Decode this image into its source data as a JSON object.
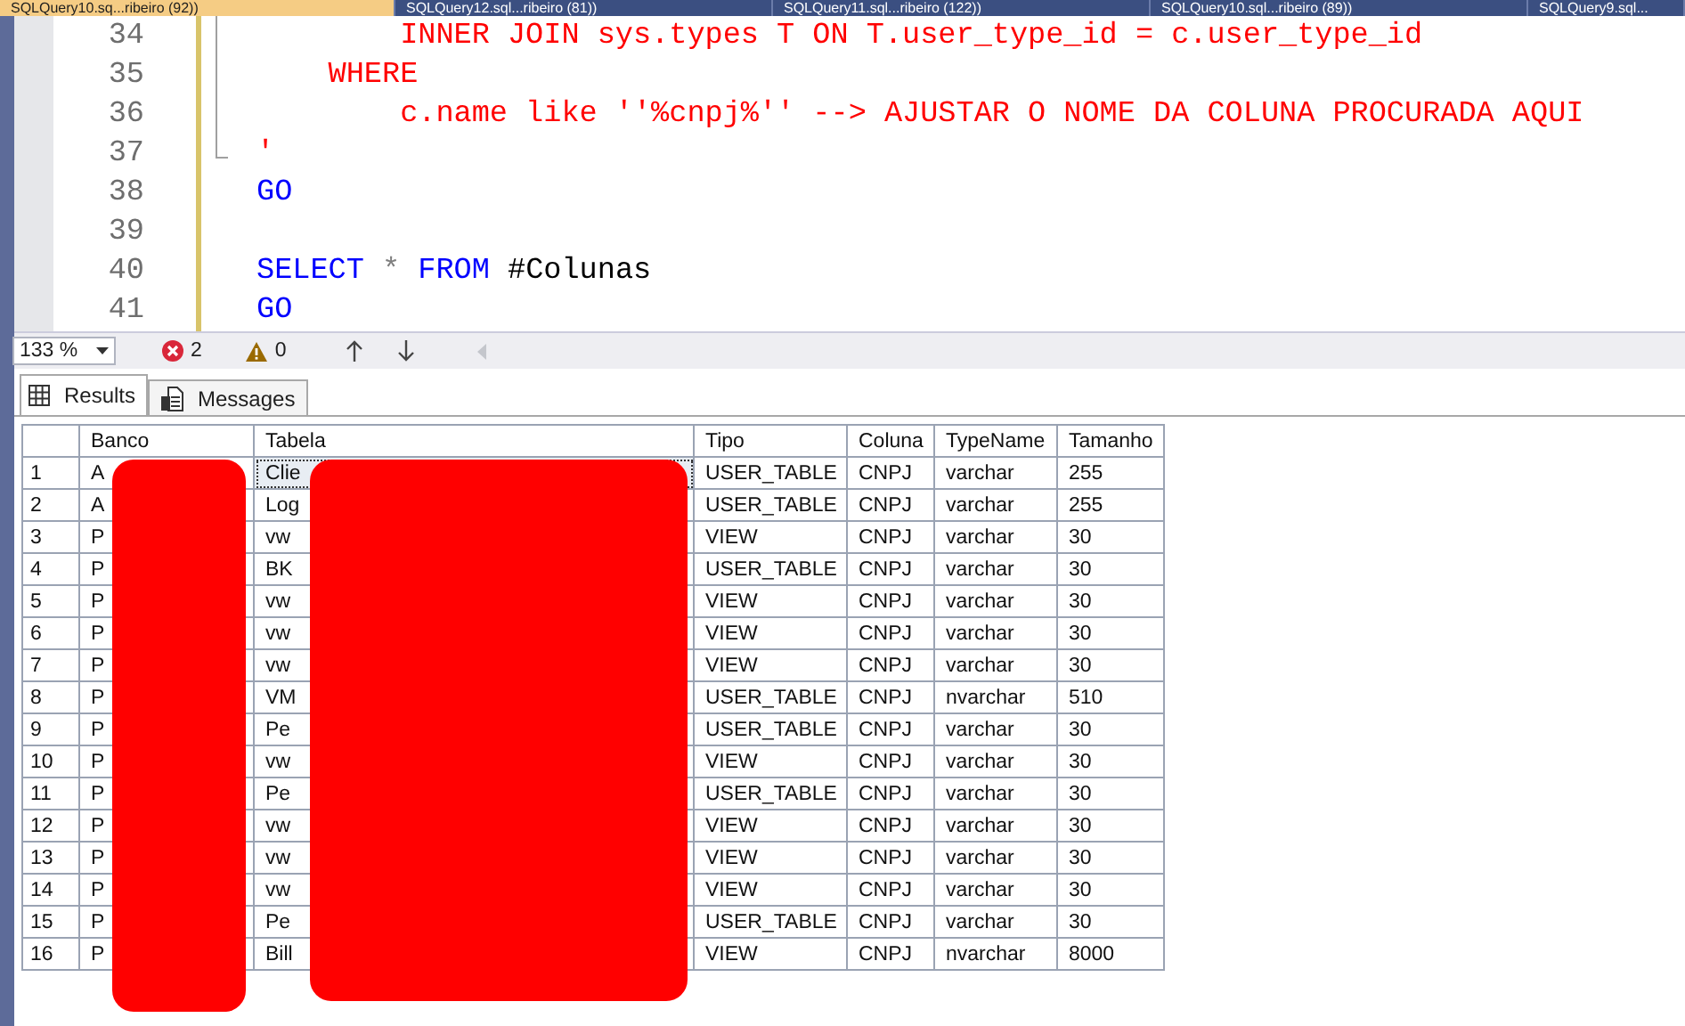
{
  "document_tabs": [
    {
      "label": "SQLQuery10.sq...ribeiro (92))",
      "selected": true
    },
    {
      "label": "SQLQuery12.sql...ribeiro (81))",
      "selected": false
    },
    {
      "label": "SQLQuery11.sql...ribeiro (122))",
      "selected": false
    },
    {
      "label": "SQLQuery10.sql...ribeiro (89))",
      "selected": false
    },
    {
      "label": "SQLQuery9.sql...",
      "selected": false
    }
  ],
  "editor": {
    "lines": [
      {
        "number": "34",
        "tokens": [
          {
            "text": "        INNER JOIN sys.types T ON T.user_type_id = c.user_type_id",
            "kind": "string"
          }
        ]
      },
      {
        "number": "35",
        "tokens": [
          {
            "text": "    WHERE",
            "kind": "string"
          }
        ]
      },
      {
        "number": "36",
        "tokens": [
          {
            "text": "        c.name like ''%cnpj%'' --> AJUSTAR O NOME DA COLUNA PROCURADA AQUI",
            "kind": "string"
          }
        ]
      },
      {
        "number": "37",
        "tokens": [
          {
            "text": "'",
            "kind": "string"
          }
        ]
      },
      {
        "number": "38",
        "tokens": [
          {
            "text": "GO",
            "kind": "keyword"
          }
        ]
      },
      {
        "number": "39"
      },
      {
        "number": "40",
        "tokens": [
          {
            "text": "SELECT",
            "kind": "keyword"
          },
          {
            "text": " * ",
            "kind": "operator"
          },
          {
            "text": "FROM",
            "kind": "keyword"
          },
          {
            "text": " #Colunas",
            "kind": "plain"
          }
        ]
      },
      {
        "number": "41",
        "tokens": [
          {
            "text": "GO",
            "kind": "keyword"
          }
        ]
      }
    ]
  },
  "toolbar": {
    "zoom": "133 %",
    "errors": "2",
    "warnings": "0"
  },
  "result_tabs": [
    {
      "label": "Results",
      "kind": "grid",
      "selected": true
    },
    {
      "label": "Messages",
      "kind": "messages",
      "selected": false
    }
  ],
  "grid": {
    "columns": [
      "Banco",
      "Tabela",
      "Tipo",
      "Coluna",
      "TypeName",
      "Tamanho"
    ],
    "rows": [
      {
        "number": "1",
        "selected": true,
        "cells": [
          "A",
          "Clie",
          "USER_TABLE",
          "CNPJ",
          "varchar",
          "255"
        ]
      },
      {
        "number": "2",
        "selected": false,
        "cells": [
          "A",
          "Log",
          "USER_TABLE",
          "CNPJ",
          "varchar",
          "255"
        ]
      },
      {
        "number": "3",
        "selected": false,
        "cells": [
          "P",
          "vw",
          "VIEW",
          "CNPJ",
          "varchar",
          "30"
        ]
      },
      {
        "number": "4",
        "selected": false,
        "cells": [
          "P",
          "BK",
          "USER_TABLE",
          "CNPJ",
          "varchar",
          "30"
        ]
      },
      {
        "number": "5",
        "selected": false,
        "cells": [
          "P",
          "vw",
          "VIEW",
          "CNPJ",
          "varchar",
          "30"
        ]
      },
      {
        "number": "6",
        "selected": false,
        "cells": [
          "P",
          "vw",
          "VIEW",
          "CNPJ",
          "varchar",
          "30"
        ]
      },
      {
        "number": "7",
        "selected": false,
        "cells": [
          "P",
          "vw",
          "VIEW",
          "CNPJ",
          "varchar",
          "30"
        ]
      },
      {
        "number": "8",
        "selected": false,
        "cells": [
          "P",
          "VM",
          "USER_TABLE",
          "CNPJ",
          "nvarchar",
          "510"
        ]
      },
      {
        "number": "9",
        "selected": false,
        "cells": [
          "P",
          "Pe",
          "USER_TABLE",
          "CNPJ",
          "varchar",
          "30"
        ]
      },
      {
        "number": "10",
        "selected": false,
        "cells": [
          "P",
          "vw",
          "VIEW",
          "CNPJ",
          "varchar",
          "30"
        ]
      },
      {
        "number": "11",
        "selected": false,
        "cells": [
          "P",
          "Pe",
          "USER_TABLE",
          "CNPJ",
          "varchar",
          "30"
        ]
      },
      {
        "number": "12",
        "selected": false,
        "cells": [
          "P",
          "vw",
          "VIEW",
          "CNPJ",
          "varchar",
          "30"
        ]
      },
      {
        "number": "13",
        "selected": false,
        "cells": [
          "P",
          "vw",
          "VIEW",
          "CNPJ",
          "varchar",
          "30"
        ]
      },
      {
        "number": "14",
        "selected": false,
        "cells": [
          "P",
          "vw",
          "VIEW",
          "CNPJ",
          "varchar",
          "30"
        ]
      },
      {
        "number": "15",
        "selected": false,
        "cells": [
          "P",
          "Pe",
          "USER_TABLE",
          "CNPJ",
          "varchar",
          "30"
        ]
      },
      {
        "number": "16",
        "selected": false,
        "cells": [
          "P",
          "Bill",
          "VIEW",
          "CNPJ",
          "nvarchar",
          "8000"
        ]
      }
    ]
  }
}
